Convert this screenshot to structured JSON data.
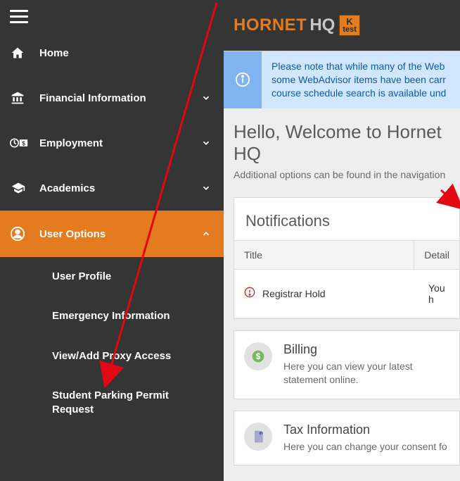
{
  "brand": {
    "part1": "HORNET",
    "part2": "HQ",
    "badge_top": "K",
    "badge_bottom": "test"
  },
  "sidebar": {
    "items": [
      {
        "id": "home",
        "label": "Home",
        "expandable": false
      },
      {
        "id": "financial",
        "label": "Financial Information",
        "expandable": true
      },
      {
        "id": "employment",
        "label": "Employment",
        "expandable": true
      },
      {
        "id": "academics",
        "label": "Academics",
        "expandable": true
      },
      {
        "id": "user-options",
        "label": "User Options",
        "expandable": true,
        "active": true
      }
    ],
    "user_options_sub": [
      {
        "id": "user-profile",
        "label": "User Profile"
      },
      {
        "id": "emergency-info",
        "label": "Emergency Information"
      },
      {
        "id": "proxy-access",
        "label": "View/Add Proxy Access"
      },
      {
        "id": "parking-permit",
        "label": "Student Parking Permit Request"
      }
    ]
  },
  "notice": {
    "text": "Please note that while many of the WebAdvisor items have been carried over, some WebAdvisor items have been carried over. Course schedule search is available und"
  },
  "notice_lines": {
    "l1": "Please note that while many of the Web",
    "l2": "some WebAdvisor items have been carr",
    "l3": "course schedule search is available und"
  },
  "welcome": {
    "heading": "Hello, Welcome to Hornet HQ",
    "sub": "Additional options can be found in the navigation"
  },
  "notifications": {
    "title": "Notifications",
    "columns": {
      "c1": "Title",
      "c2": "Detail"
    },
    "rows": [
      {
        "title": "Registrar Hold",
        "detail": "You h"
      }
    ]
  },
  "cards": [
    {
      "id": "billing",
      "title": "Billing",
      "desc": "Here you can view your latest statement online."
    },
    {
      "id": "tax",
      "title": "Tax Information",
      "desc": "Here you can change your consent fo"
    }
  ]
}
